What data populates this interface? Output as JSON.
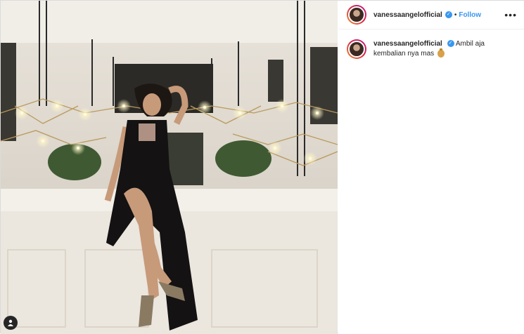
{
  "post": {
    "username": "vanessaangelofficial",
    "verified": true,
    "separator": "•",
    "follow_label": "Follow",
    "more_label": "•••",
    "caption_username": "vanessaangelofficial",
    "caption_text": "Ambil aja kembalian nya mas",
    "caption_emoji": "money-bag-icon"
  },
  "colors": {
    "accent": "#3897f0",
    "text": "#262626",
    "border": "#dbdbdb"
  }
}
